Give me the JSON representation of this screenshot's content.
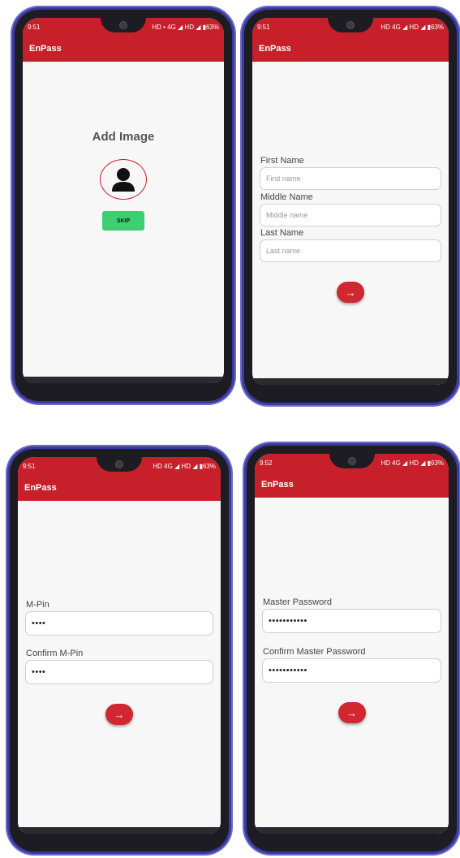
{
  "screens": [
    {
      "status": {
        "time": "9:51",
        "right": "HD • 4G ◢ HD ◢ ▮63%"
      },
      "app_title": "EnPass",
      "heading": "Add Image",
      "skip_label": "SKIP"
    },
    {
      "status": {
        "time": "9:51",
        "right": "HD 4G ◢ HD ◢ ▮63%"
      },
      "app_title": "EnPass",
      "fields": [
        {
          "label": "First Name",
          "placeholder": "First name"
        },
        {
          "label": "Middle Name",
          "placeholder": "Middle name"
        },
        {
          "label": "Last Name",
          "placeholder": "Last name"
        }
      ],
      "next_icon": "arrow-right-icon"
    },
    {
      "status": {
        "time": "9:51",
        "right": "HD 4G ◢ HD ◢ ▮63%"
      },
      "app_title": "EnPass",
      "fields": [
        {
          "label": "M-Pin",
          "value": "••••"
        },
        {
          "label": "Confirm M-Pin",
          "value": "••••"
        }
      ],
      "next_icon": "arrow-right-icon"
    },
    {
      "status": {
        "time": "9:52",
        "right": "HD 4G ◢ HD ◢ ▮63%"
      },
      "app_title": "EnPass",
      "fields": [
        {
          "label": "Master Password",
          "value": "•••••••••••"
        },
        {
          "label": "Confirm Master Password",
          "value": "•••••••••••"
        }
      ],
      "next_icon": "arrow-right-icon"
    }
  ],
  "colors": {
    "primary": "#c8202a",
    "skip": "#3ecf72",
    "frame": "#1c1c22",
    "frame_edge": "#3b3aa0"
  }
}
